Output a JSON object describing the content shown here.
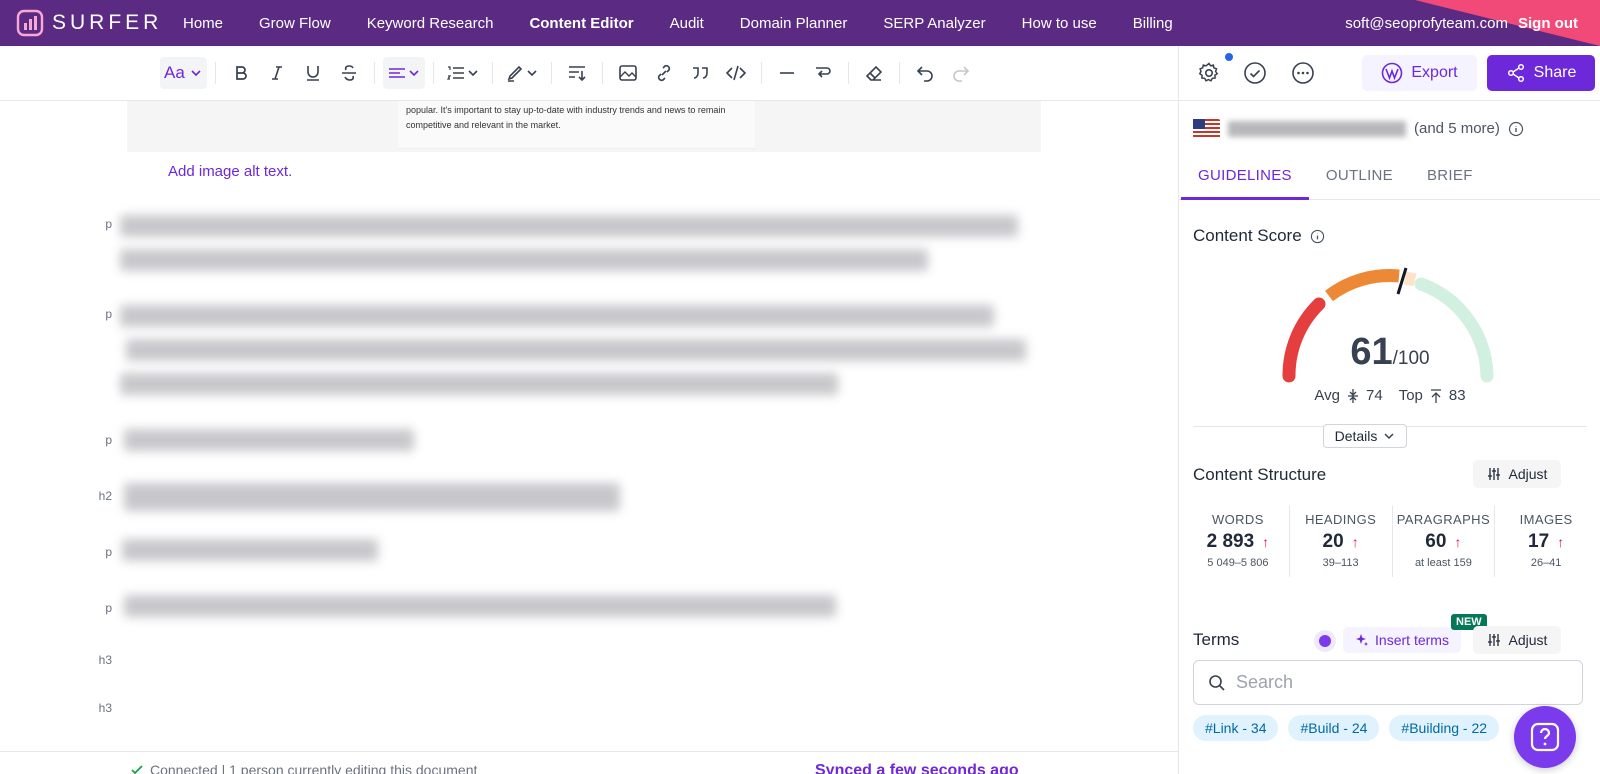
{
  "brand": {
    "name": "SURFER"
  },
  "nav": {
    "items": [
      "Home",
      "Grow Flow",
      "Keyword Research",
      "Content Editor",
      "Audit",
      "Domain Planner",
      "SERP Analyzer",
      "How to use",
      "Billing"
    ],
    "active": "Content Editor",
    "email": "soft@seoprofyteam.com",
    "signout": "Sign out"
  },
  "toolbar": {
    "font_label": "Aa",
    "icons": [
      "font-size-icon",
      "bold-icon",
      "italic-icon",
      "underline-icon",
      "strikethrough-icon",
      "align-icon",
      "list-icon",
      "highlight-icon",
      "line-height-icon",
      "image-icon",
      "link-icon",
      "quote-icon",
      "code-icon",
      "horizontal-rule-icon",
      "line-break-icon",
      "eraser-icon",
      "undo-icon",
      "redo-icon"
    ]
  },
  "editor": {
    "image_caption_line1": "popular. It's important to stay up-to-date with industry trends and news to remain",
    "image_caption_line2": "competitive and relevant in the market.",
    "alt_text_link": "Add image alt text.",
    "blocks": [
      {
        "tag": "p"
      },
      {
        "tag": "p"
      },
      {
        "tag": "p"
      },
      {
        "tag": "h2"
      },
      {
        "tag": "p"
      },
      {
        "tag": "p"
      },
      {
        "tag": "h3"
      },
      {
        "tag": "h3"
      }
    ]
  },
  "status": {
    "connected": "Connected | 1 person currently editing this document",
    "synced": "Synced a few seconds ago"
  },
  "panel": {
    "export_label": "Export",
    "share_label": "Share",
    "location_suffix": "(and 5 more)",
    "tabs": [
      "GUIDELINES",
      "OUTLINE",
      "BRIEF"
    ],
    "active_tab": "GUIDELINES",
    "content_score": {
      "title": "Content Score",
      "score": "61",
      "max": "/100",
      "avg_label": "Avg",
      "avg": "74",
      "top_label": "Top",
      "top": "83",
      "details_label": "Details"
    },
    "structure": {
      "title": "Content Structure",
      "adjust_label": "Adjust",
      "stats": [
        {
          "label": "WORDS",
          "value": "2 893",
          "range": "5 049–5 806"
        },
        {
          "label": "HEADINGS",
          "value": "20",
          "range": "39–113"
        },
        {
          "label": "PARAGRAPHS",
          "value": "60",
          "range": "at least 159"
        },
        {
          "label": "IMAGES",
          "value": "17",
          "range": "26–41"
        }
      ]
    },
    "terms": {
      "title": "Terms",
      "insert_label": "Insert terms",
      "new_badge": "NEW",
      "adjust_label": "Adjust",
      "search_placeholder": "Search",
      "chips": [
        "#Link - 34",
        "#Build - 24",
        "#Building - 22"
      ]
    }
  },
  "colors": {
    "nav_bg": "#5b2a83",
    "accent": "#6d28d9",
    "gauge_low": "#e53e3e",
    "gauge_mid": "#ed8936",
    "gauge_high": "#d1f0df"
  }
}
